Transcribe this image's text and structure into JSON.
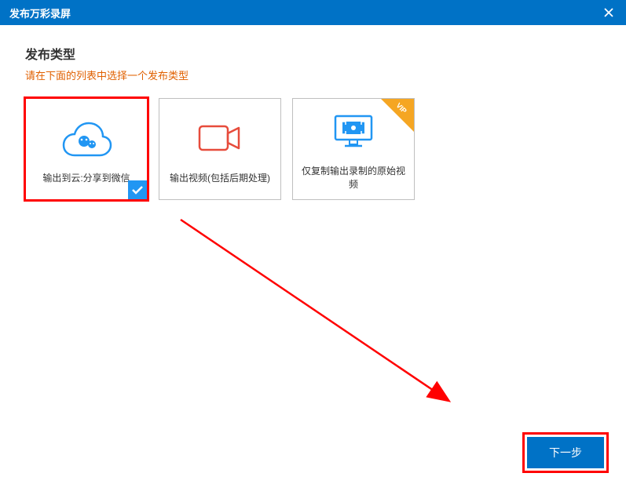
{
  "titlebar": {
    "title": "发布万彩录屏"
  },
  "content": {
    "heading": "发布类型",
    "subtitle": "请在下面的列表中选择一个发布类型"
  },
  "options": [
    {
      "label": "输出到云:分享到微信",
      "selected": true,
      "highlighted": true,
      "icon": "cloud",
      "vip": false
    },
    {
      "label": "输出视频(包括后期处理)",
      "selected": false,
      "highlighted": false,
      "icon": "camera",
      "vip": false
    },
    {
      "label": "仅复制输出录制的原始视频",
      "selected": false,
      "highlighted": false,
      "icon": "monitor",
      "vip": true
    }
  ],
  "buttons": {
    "next": "下一步"
  },
  "vip_label": "VIP"
}
